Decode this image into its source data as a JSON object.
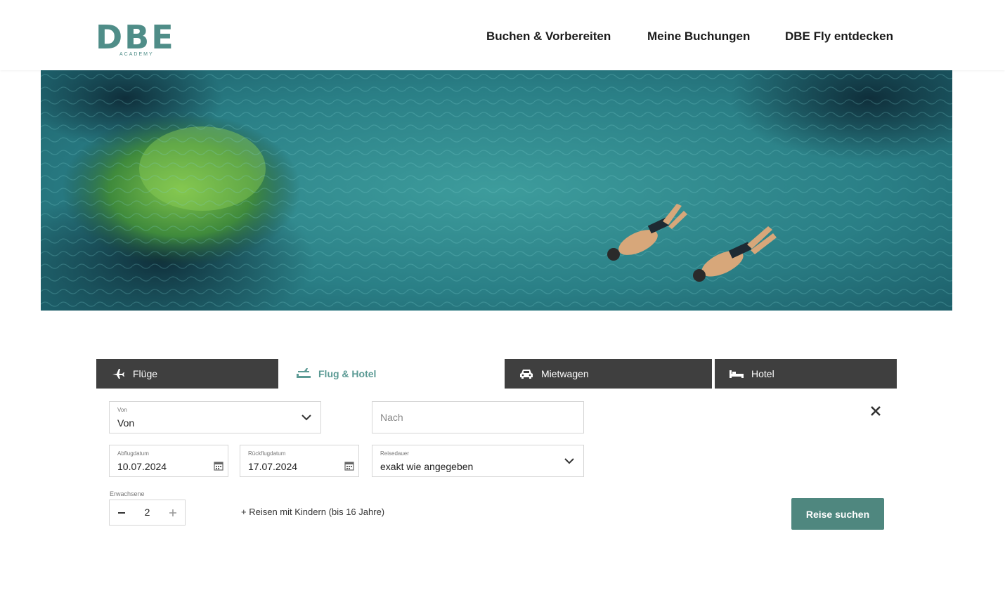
{
  "header": {
    "logo_text": "DBE",
    "logo_sub": "ACADEMY",
    "nav": [
      "Buchen & Vorbereiten",
      "Meine Buchungen",
      "DBE Fly entdecken"
    ]
  },
  "tabs": [
    {
      "label": "Flüge",
      "icon": "plane-icon"
    },
    {
      "label": "Flug & Hotel",
      "icon": "plane-hotel-icon"
    },
    {
      "label": "Mietwagen",
      "icon": "car-icon"
    },
    {
      "label": "Hotel",
      "icon": "bed-icon"
    }
  ],
  "form": {
    "from": {
      "label": "Von",
      "value": "Von"
    },
    "to": {
      "placeholder": "Nach"
    },
    "departure": {
      "label": "Abflugdatum",
      "value": "10.07.2024"
    },
    "return": {
      "label": "Rückflugdatum",
      "value": "17.07.2024"
    },
    "duration": {
      "label": "Reisedauer",
      "value": "exakt wie angegeben"
    },
    "adults": {
      "label": "Erwachsene",
      "value": "2"
    },
    "kids_link": "+ Reisen mit Kindern (bis 16 Jahre)",
    "search_button": "Reise suchen"
  },
  "colors": {
    "accent": "#4f877f",
    "tab_dark": "#3f3f3f"
  }
}
